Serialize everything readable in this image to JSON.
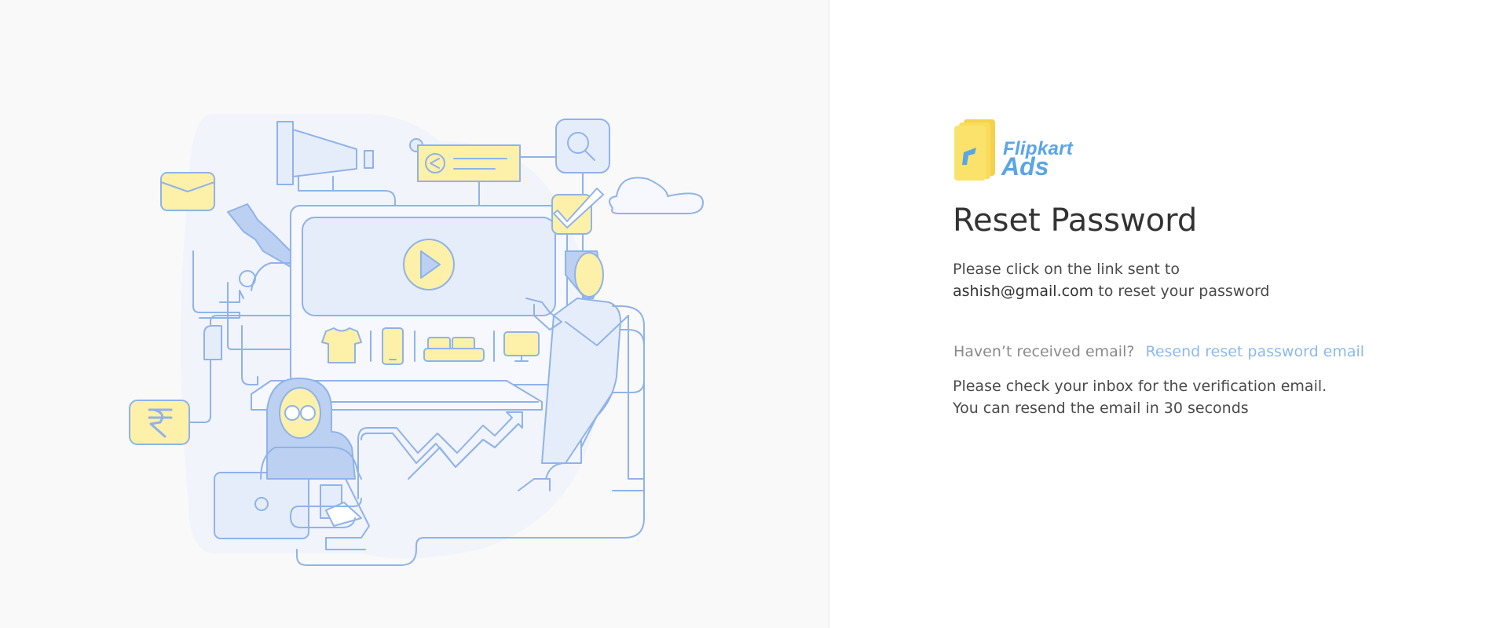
{
  "brand": {
    "name": "Flipkart",
    "product": "Ads"
  },
  "reset": {
    "title": "Reset Password",
    "desc_line1": "Please click on the link sent to",
    "email": "ashish@gmail.com",
    "desc_line2_rest": " to reset your password",
    "resend_question": "Haven’t received email?",
    "resend_link": "Resend reset password email",
    "notice_line1": "Please check your inbox for the verification email.",
    "notice_line2_prefix": "You can resend the email in ",
    "countdown_seconds": "30",
    "notice_line2_suffix": " seconds"
  },
  "colors": {
    "accent_blue": "#5aa5e6",
    "link_blue": "#8db9ee",
    "illustration_stroke": "#8fb3ea",
    "illustration_yellow": "#fdf0a8",
    "illustration_blue_fill": "#e6edfa",
    "panel_bg": "#f9f9f9"
  },
  "icons": [
    "flipkart-ads-logo-icon",
    "marketing-illustration",
    "envelope-icon",
    "megaphone-icon",
    "share-icon",
    "search-icon",
    "check-icon",
    "cloud-icon",
    "play-icon",
    "rupee-icon",
    "tshirt-icon",
    "phone-icon",
    "sofa-icon",
    "tv-icon",
    "laptop-icon",
    "trend-arrow-icon"
  ]
}
